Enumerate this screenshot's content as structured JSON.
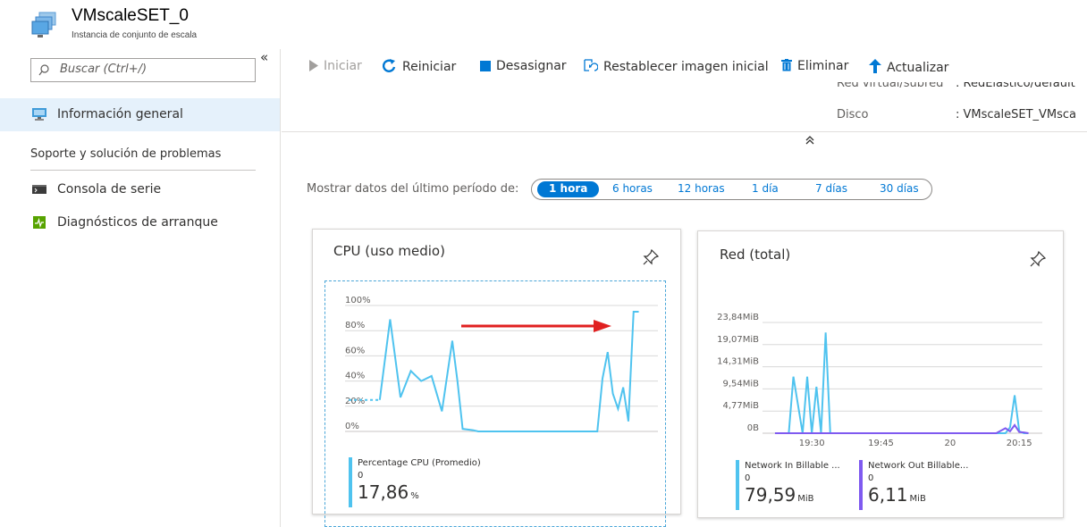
{
  "header": {
    "title": "VMscaleSET_0",
    "subtitle": "Instancia de conjunto de escala"
  },
  "sidebar": {
    "search_placeholder": "Buscar (Ctrl+/)",
    "collapse_glyph": "«",
    "items": [
      {
        "label": "Información general",
        "icon": "overview-monitor-icon",
        "active": true
      }
    ],
    "section": "Soporte y solución de problemas",
    "support_items": [
      {
        "label": "Consola de serie",
        "icon": "console-icon"
      },
      {
        "label": "Diagnósticos de arranque",
        "icon": "boot-diagnostics-icon"
      }
    ]
  },
  "toolbar": {
    "start": "Iniciar",
    "restart": "Reiniciar",
    "deallocate": "Desasignar",
    "reimage": "Restablecer imagen inicial",
    "delete": "Eliminar",
    "refresh": "Actualizar"
  },
  "properties": {
    "vnet_label": "Red virtual/subred",
    "vnet_value": ": RedElastico/default",
    "disk_label": "Disco",
    "disk_value": ": VMscaleSET_VMsca",
    "collapse_glyph": "⌃"
  },
  "time_range": {
    "label": "Mostrar datos del último período de:",
    "options": [
      "1 hora",
      "6 horas",
      "12 horas",
      "1 día",
      "7 días",
      "30 días"
    ],
    "selected": "1 hora"
  },
  "colors": {
    "accent": "#0078d4",
    "series_in": "#4fc3ef",
    "series_out": "#7f5af0",
    "arrow": "#e02020"
  },
  "cpu_card": {
    "title": "CPU (uso medio)",
    "legend_name": "Percentage CPU (Promedio)",
    "legend_sub": "0",
    "legend_value": "17,86",
    "legend_unit": "%"
  },
  "net_card": {
    "title": "Red (total)",
    "in_name": "Network In Billable ...",
    "in_sub": "0",
    "in_value": "79,59",
    "in_unit": "MiB",
    "out_name": "Network Out Billable...",
    "out_sub": "0",
    "out_value": "6,11",
    "out_unit": "MiB"
  },
  "chart_data": [
    {
      "type": "line",
      "title": "CPU (uso medio)",
      "x_ticks": [
        "19:30",
        "19:45",
        "20",
        "20:15"
      ],
      "y_ticks": [
        "0%",
        "20%",
        "40%",
        "60%",
        "80%",
        "100%"
      ],
      "ylim": [
        0,
        100
      ],
      "xlim_minutes": [
        19.3,
        79.7
      ],
      "series": [
        {
          "name": "Percentage CPU (Promedio)",
          "x": [
            20,
            26,
            28,
            30,
            32,
            34,
            36,
            38,
            40,
            41,
            42,
            44,
            45,
            46,
            60,
            66,
            68,
            69,
            70,
            71,
            72,
            73,
            74,
            75,
            76
          ],
          "y": [
            25,
            25,
            89,
            27,
            48,
            40,
            44,
            16,
            72,
            40,
            2,
            1,
            0,
            0,
            0,
            0,
            0,
            42,
            63,
            30,
            18,
            35,
            8,
            95,
            95
          ],
          "dashed_before": 26
        }
      ]
    },
    {
      "type": "line",
      "title": "Red (total)",
      "x_ticks": [
        "19:30",
        "19:45",
        "20",
        "20:15"
      ],
      "y_ticks": [
        "0B",
        "4,77MiB",
        "9,54MiB",
        "14,31MiB",
        "19,07MiB",
        "23,84MiB"
      ],
      "ylim": [
        0,
        28.6
      ],
      "xlim_minutes": [
        19.3,
        80
      ],
      "series": [
        {
          "name": "Network In Billable ...",
          "x": [
            25,
            26,
            28,
            29,
            30,
            31,
            32,
            33,
            34,
            35,
            36,
            37,
            38,
            72,
            73,
            74,
            75,
            76,
            77
          ],
          "y": [
            0,
            14.6,
            0,
            14.6,
            0,
            12,
            0,
            26,
            0,
            0,
            0,
            0,
            0,
            0,
            1.5,
            9.8,
            0.5,
            0,
            0
          ]
        },
        {
          "name": "Network Out Billable...",
          "x": [
            22,
            40,
            60,
            70,
            72,
            73,
            74,
            75,
            76,
            77
          ],
          "y": [
            0,
            0,
            0,
            0,
            1.3,
            0.5,
            2.1,
            0.3,
            0.2,
            0
          ]
        }
      ]
    }
  ]
}
